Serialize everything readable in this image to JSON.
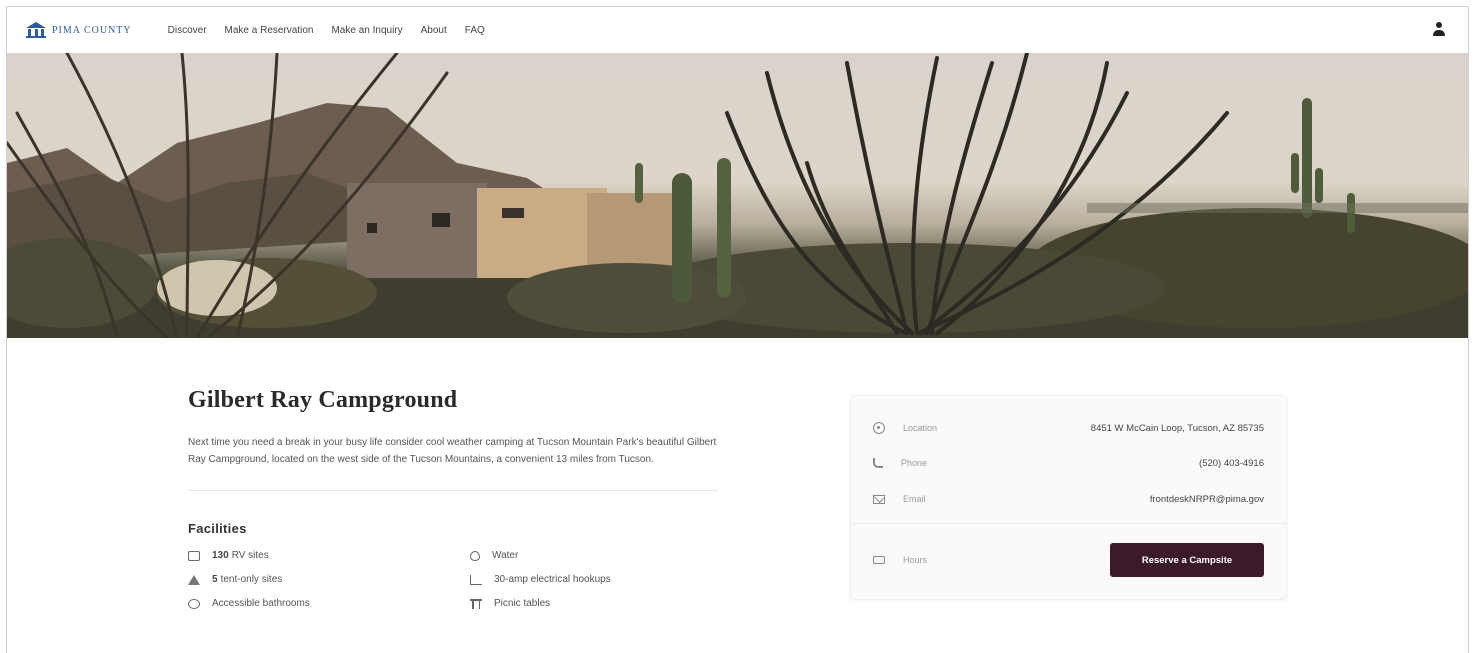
{
  "brand": {
    "name": "PIMA COUNTY",
    "color": "#2f5a9a"
  },
  "nav": {
    "links": [
      "Discover",
      "Make a Reservation",
      "Make an Inquiry",
      "About",
      "FAQ"
    ]
  },
  "page": {
    "title": "Gilbert Ray Campground",
    "description": "Next time you need a break in your busy life consider cool weather camping at Tucson Mountain Park's beautiful Gilbert Ray Campground, located on the west side of the Tucson Mountains, a convenient 13 miles from Tucson.",
    "facilities_heading": "Facilities",
    "facilities": [
      {
        "icon": "rv-icon",
        "count": "130",
        "label": "RV sites"
      },
      {
        "icon": "water-icon",
        "count": "",
        "label": "Water"
      },
      {
        "icon": "tent-icon",
        "count": "5",
        "label": "tent-only sites"
      },
      {
        "icon": "plug-icon",
        "count": "",
        "label": "30-amp electrical hookups"
      },
      {
        "icon": "accessible-icon",
        "count": "",
        "label": "Accessible bathrooms"
      },
      {
        "icon": "picnic-table-icon",
        "count": "",
        "label": "Picnic tables"
      }
    ]
  },
  "card": {
    "location_label": "Location",
    "location_value": "8451 W McCain Loop, Tucson, AZ 85735",
    "phone_label": "Phone",
    "phone_value": "(520) 403-4916",
    "email_label": "Email",
    "email_value": "frontdeskNRPR@pima.gov",
    "hours_label": "Hours",
    "reserve_label": "Reserve a Campsite",
    "reserve_color": "#3b1a2b"
  }
}
